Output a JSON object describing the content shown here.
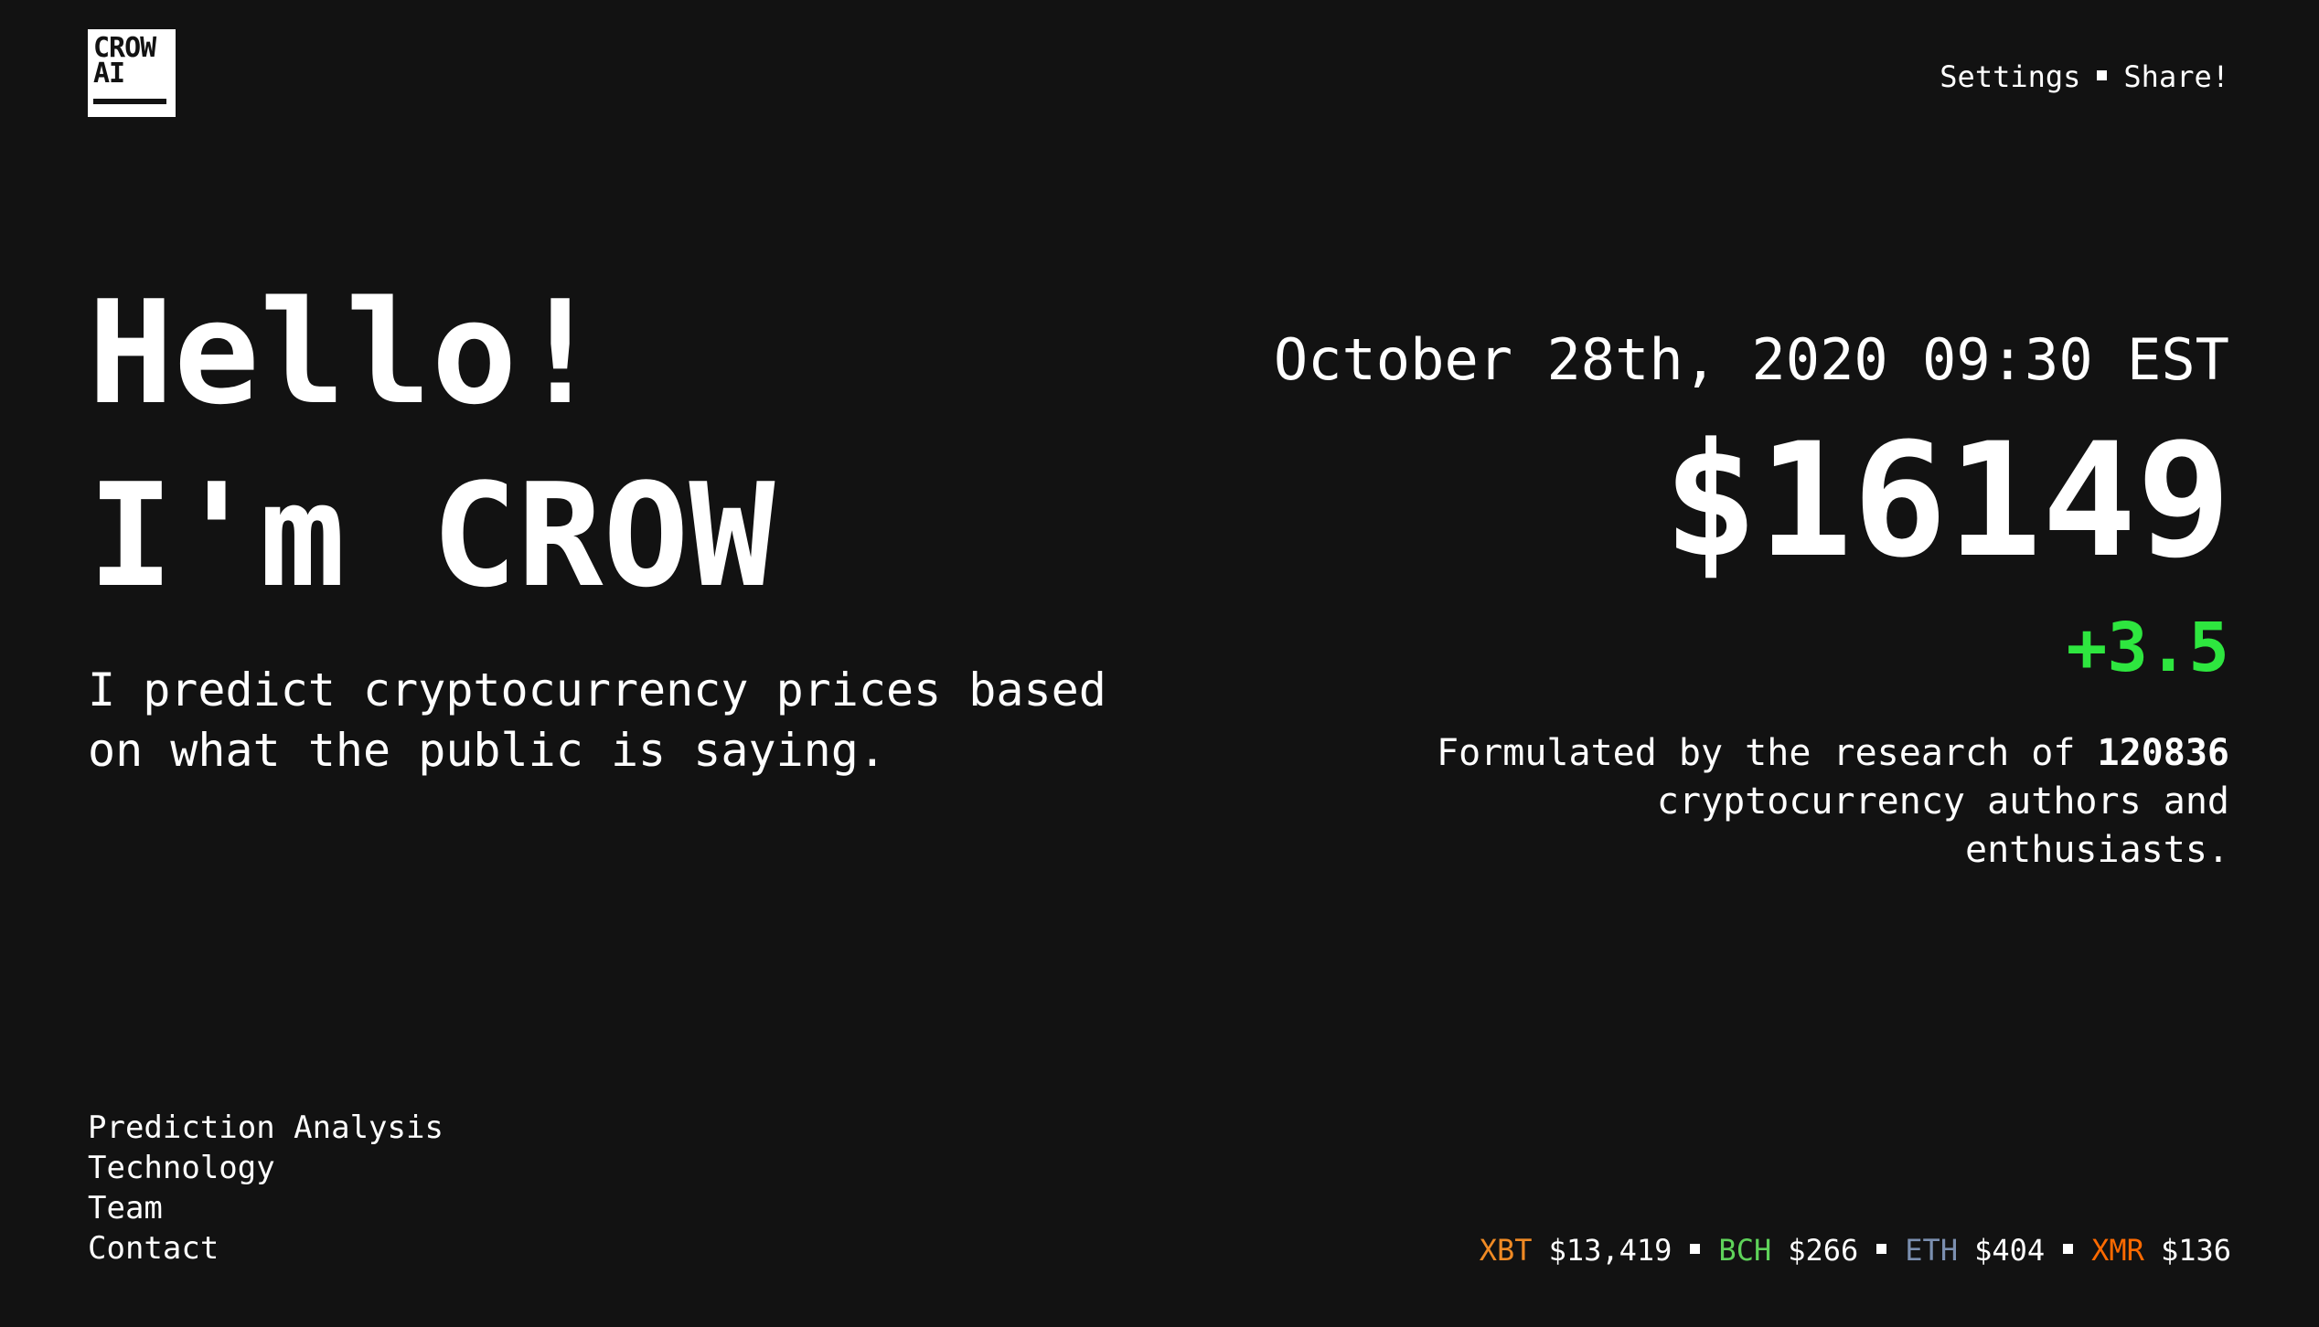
{
  "logo": {
    "line1": "CROW",
    "line2": "AI"
  },
  "top_nav": {
    "settings": "Settings",
    "share": "Share!"
  },
  "hero": {
    "line1": "Hello!",
    "line2": "I'm CROW",
    "subtitle": "I predict cryptocurrency prices based on what the public is saying."
  },
  "prediction": {
    "datetime": "October 28th, 2020 09:30 EST",
    "price": "$16149",
    "change": "+3.5",
    "change_color": "#2ee63f",
    "formulated_prefix": "Formulated by the research of",
    "author_count": "120836",
    "formulated_suffix": "cryptocurrency authors and enthusiasts."
  },
  "footer_nav": [
    {
      "label": "Prediction Analysis"
    },
    {
      "label": "Technology"
    },
    {
      "label": "Team"
    },
    {
      "label": "Contact"
    }
  ],
  "ticker": [
    {
      "symbol": "XBT",
      "price": "$13,419",
      "color": "#f08a24"
    },
    {
      "symbol": "BCH",
      "price": "$266",
      "color": "#5fd35a"
    },
    {
      "symbol": "ETH",
      "price": "$404",
      "color": "#7b8fb0"
    },
    {
      "symbol": "XMR",
      "price": "$136",
      "color": "#ff6a00"
    }
  ]
}
